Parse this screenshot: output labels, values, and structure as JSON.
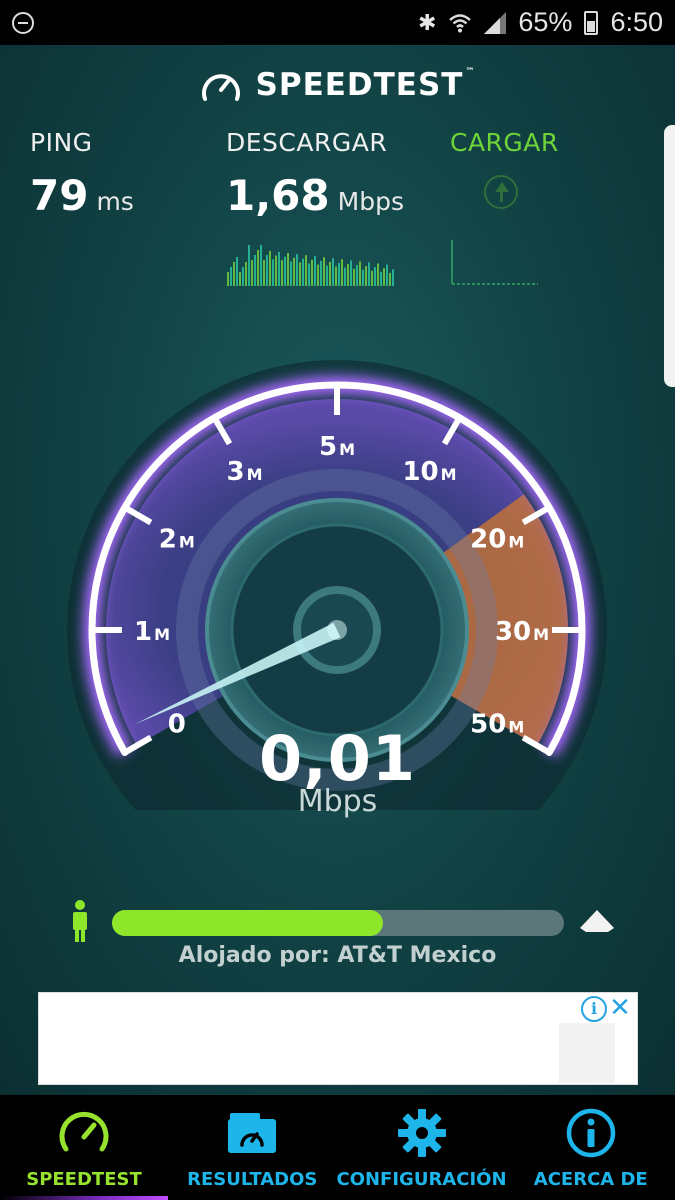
{
  "status_bar": {
    "battery_percent": "65%",
    "time": "6:50"
  },
  "header": {
    "app_name": "SPEEDTEST",
    "trademark": "™"
  },
  "stats": {
    "ping": {
      "label": "PING",
      "value": "79",
      "unit": "ms"
    },
    "download": {
      "label": "DESCARGAR",
      "value": "1,68",
      "unit": "Mbps"
    },
    "upload": {
      "label": "CARGAR",
      "value": "",
      "unit": ""
    }
  },
  "gauge": {
    "current_value": "0,01",
    "unit": "Mbps",
    "tick_labels": [
      {
        "num": "0",
        "suffix": ""
      },
      {
        "num": "1",
        "suffix": "M"
      },
      {
        "num": "2",
        "suffix": "M"
      },
      {
        "num": "3",
        "suffix": "M"
      },
      {
        "num": "5",
        "suffix": "M"
      },
      {
        "num": "10",
        "suffix": "M"
      },
      {
        "num": "20",
        "suffix": "M"
      },
      {
        "num": "30",
        "suffix": "M"
      },
      {
        "num": "50",
        "suffix": "M"
      }
    ],
    "colors": {
      "arc": "#ffffff",
      "glow": "#a86bff",
      "dial": "#3b3f7a",
      "hot_zone": "#d2782e"
    }
  },
  "progress": {
    "fraction": 0.6,
    "hosted_by": "Alojado por: AT&T Mexico",
    "color": "#8ee62a"
  },
  "ad": {
    "info_symbol": "i",
    "close_symbol": "✕"
  },
  "nav": {
    "items": [
      {
        "label": "SPEEDTEST",
        "icon": "speedometer-icon",
        "active": true
      },
      {
        "label": "RESULTADOS",
        "icon": "results-folder-icon",
        "active": false
      },
      {
        "label": "CONFIGURACIÓN",
        "icon": "gear-icon",
        "active": false
      },
      {
        "label": "ACERCA DE",
        "icon": "info-icon",
        "active": false
      }
    ]
  }
}
